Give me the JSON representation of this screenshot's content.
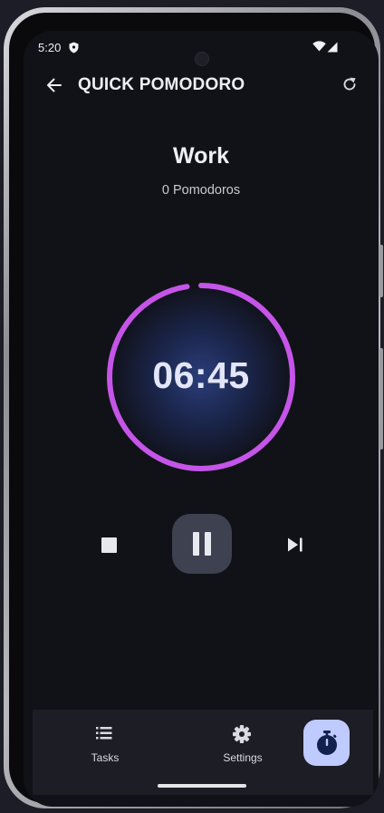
{
  "status_bar": {
    "time": "5:20"
  },
  "app_bar": {
    "title": "QUICK POMODORO"
  },
  "session": {
    "phase": "Work",
    "pomodoros": "0 Pomodoros",
    "remaining_time": "06:45",
    "progress": 0.975
  },
  "controls": {
    "stop_icon": "stop-icon",
    "pause_icon": "pause-icon",
    "skip_icon": "skip-next-icon"
  },
  "bottom_nav": {
    "items": [
      {
        "label": "Tasks",
        "icon": "list-icon"
      },
      {
        "label": "Settings",
        "icon": "gear-icon"
      }
    ],
    "fab_icon": "timer-icon"
  },
  "colors": {
    "accent_ring": "#c555e8",
    "fab": "#bfcaff",
    "background": "#111217"
  }
}
